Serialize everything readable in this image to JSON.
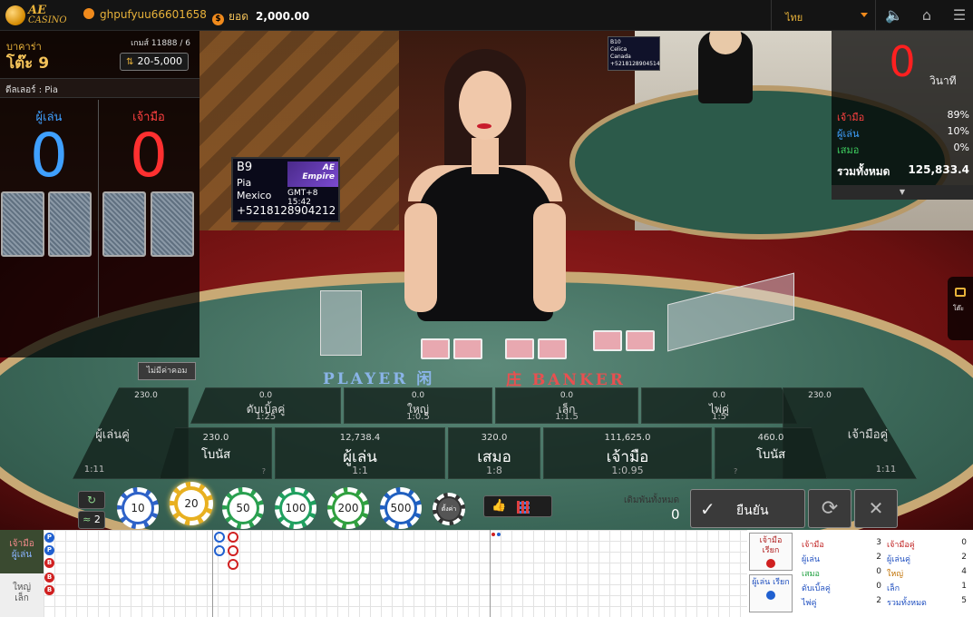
{
  "topbar": {
    "logo_top": "AE",
    "logo_bottom": "CASINO",
    "username": "ghpufyuu66601658",
    "balance_label": "ยอด",
    "balance_value": "2,000.00",
    "language": "ไทย",
    "icons": [
      "sound-icon",
      "home-icon",
      "menu-icon"
    ]
  },
  "monitor": {
    "table_id": "B9",
    "dealer_name": "Pia",
    "city": "Mexico",
    "phone": "+5218128904212",
    "brand_line1": "AE",
    "brand_line2": "Empire",
    "time": "GMT+8 15:42"
  },
  "monitor2": {
    "table_id": "B10",
    "dealer_name": "Celica",
    "city": "Canada",
    "phone": "+5218128904514"
  },
  "left_panel": {
    "game_type": "บาคาร่า",
    "table_name": "โต๊ะ 9",
    "round": "เกมส์ 11888 / 6",
    "limit": "20-5,000",
    "dealer": "ดีลเลอร์ : Pia",
    "player_label": "ผู้เล่น",
    "banker_label": "เจ้ามือ",
    "player_score": "0",
    "banker_score": "0"
  },
  "right_panel": {
    "timer": "0",
    "timer_unit": "วินาที",
    "rows": [
      {
        "label": "เจ้ามือ",
        "value": "89%",
        "color": "#ff4040"
      },
      {
        "label": "ผู้เล่น",
        "value": "10%",
        "color": "#3fa0ff"
      },
      {
        "label": "เสมอ",
        "value": "0%",
        "color": "#3fd060"
      }
    ],
    "total_label": "รวมทั้งหมด",
    "total_value": "125,833.4",
    "chat_label": "โต๊ะ"
  },
  "table": {
    "no_commission": "ไม่มีค่าคอม",
    "player_label": "PLAYER 闲",
    "banker_label": "庄 BANKER"
  },
  "bets": [
    {
      "id": "player-pair",
      "amount": "230.0",
      "name": "ผู้เล่นคู่",
      "odds": "1:11"
    },
    {
      "id": "either-pair",
      "amount": "0.0",
      "name": "ดับเบิ้ลคู่",
      "odds": "1:25"
    },
    {
      "id": "big",
      "amount": "0.0",
      "name": "ใหญ่",
      "odds": "1:0.5"
    },
    {
      "id": "small",
      "amount": "0.0",
      "name": "เล็ก",
      "odds": "1:1.5"
    },
    {
      "id": "perfect-pair",
      "amount": "0.0",
      "name": "ไพ่คู่",
      "odds": "1:5"
    },
    {
      "id": "banker-pair",
      "amount": "230.0",
      "name": "เจ้ามือคู่",
      "odds": "1:11"
    },
    {
      "id": "player-bonus",
      "amount": "230.0",
      "name": "โบนัส",
      "odds": ""
    },
    {
      "id": "player",
      "amount": "12,738.4",
      "name": "ผู้เล่น",
      "odds": "1:1"
    },
    {
      "id": "tie",
      "amount": "320.0",
      "name": "เสมอ",
      "odds": "1:8"
    },
    {
      "id": "banker",
      "amount": "111,625.0",
      "name": "เจ้ามือ",
      "odds": "1:0.95"
    },
    {
      "id": "banker-bonus",
      "amount": "460.0",
      "name": "โบนัส",
      "odds": ""
    }
  ],
  "controls": {
    "refresh_icon": "refresh-icon",
    "wifi_count": "2",
    "chips": [
      {
        "value": "10",
        "color": "#2e62c8"
      },
      {
        "value": "20",
        "color": "#e8b020"
      },
      {
        "value": "50",
        "color": "#2aa050"
      },
      {
        "value": "100",
        "color": "#20a060"
      },
      {
        "value": "200",
        "color": "#30a040"
      },
      {
        "value": "500",
        "color": "#2060c0"
      }
    ],
    "chip_custom": "ตั้งค่า",
    "total_bet_label": "เดิมพันทั้งหมด",
    "total_bet_value": "0",
    "confirm_label": "ยืนยัน"
  },
  "roadmap": {
    "tab1_a": "เจ้ามือ",
    "tab1_b": "ผู้เล่น",
    "tab2_a": "ใหญ่",
    "tab2_b": "เล็ก",
    "bead_road": [
      "P",
      "P",
      "B",
      "B",
      "B"
    ],
    "ask_banker": "เจ้ามือ เรียก",
    "ask_player": "ผู้เล่น เรียก",
    "stats": [
      {
        "label": "เจ้ามือ",
        "value": "3",
        "color": "#c02020"
      },
      {
        "label": "เจ้ามือคู่",
        "value": "0",
        "color": "#c02020"
      },
      {
        "label": "ผู้เล่น",
        "value": "2",
        "color": "#2050c0"
      },
      {
        "label": "ผู้เล่นคู่",
        "value": "2",
        "color": "#2050c0"
      },
      {
        "label": "เสมอ",
        "value": "0",
        "color": "#20a040"
      },
      {
        "label": "ใหญ่",
        "value": "4",
        "color": "#c07000"
      },
      {
        "label": "ดับเบิ้ลคู่",
        "value": "0",
        "color": "#2050c0"
      },
      {
        "label": "เล็ก",
        "value": "1",
        "color": "#2050c0"
      },
      {
        "label": "ไพ่คู่",
        "value": "2",
        "color": "#2050c0"
      },
      {
        "label": "รวมทั้งหมด",
        "value": "5",
        "color": "#2050c0"
      }
    ]
  }
}
